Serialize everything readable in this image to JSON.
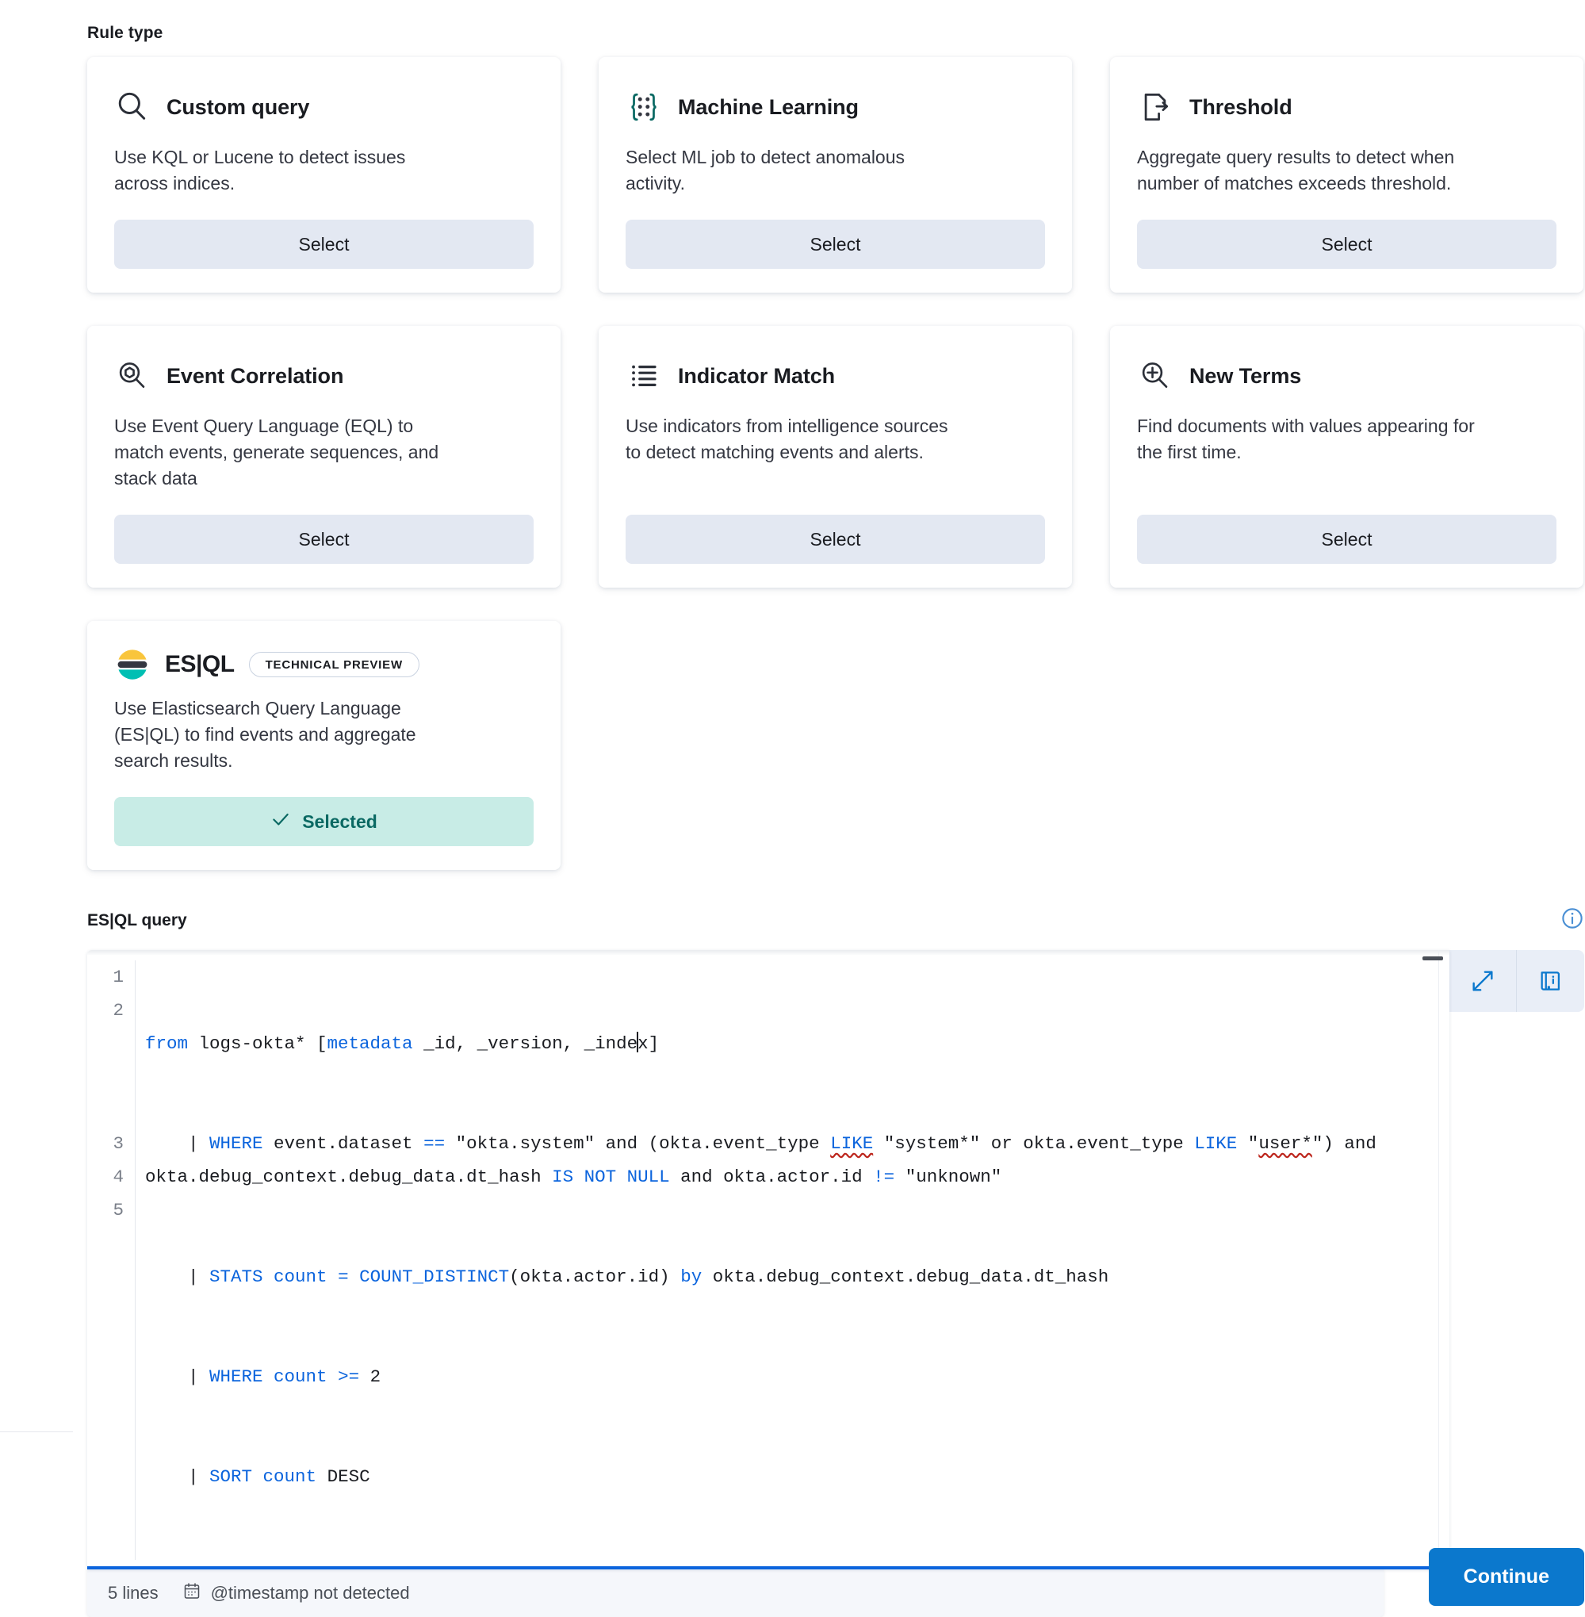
{
  "section": {
    "label": "Rule type"
  },
  "rule_types": [
    {
      "id": "custom-query",
      "icon": "search-icon",
      "title": "Custom query",
      "description": "Use KQL or Lucene to detect issues across indices.",
      "action_label": "Select",
      "selected": false
    },
    {
      "id": "machine-learning",
      "icon": "machine-learning-icon",
      "title": "Machine Learning",
      "description": "Select ML job to detect anomalous activity.",
      "action_label": "Select",
      "selected": false
    },
    {
      "id": "threshold",
      "icon": "threshold-icon",
      "title": "Threshold",
      "description": "Aggregate query results to detect when number of matches exceeds threshold.",
      "action_label": "Select",
      "selected": false
    },
    {
      "id": "event-correlation",
      "icon": "event-correlation-icon",
      "title": "Event Correlation",
      "description": "Use Event Query Language (EQL) to match events, generate sequences, and stack data",
      "action_label": "Select",
      "selected": false
    },
    {
      "id": "indicator-match",
      "icon": "indicator-match-icon",
      "title": "Indicator Match",
      "description": "Use indicators from intelligence sources to detect matching events and alerts.",
      "action_label": "Select",
      "selected": false
    },
    {
      "id": "new-terms",
      "icon": "new-terms-icon",
      "title": "New Terms",
      "description": "Find documents with values appearing for the first time.",
      "action_label": "Select",
      "selected": false
    }
  ],
  "esql_card": {
    "id": "esql",
    "icon": "elastic-logo-icon",
    "wordmark": "ES|QL",
    "badge": "TECHNICAL PREVIEW",
    "description": "Use Elasticsearch Query Language (ES|QL) to find events and aggregate search results.",
    "action_label": "Selected",
    "selected": true
  },
  "query_section": {
    "label": "ES|QL query",
    "info_icon": "info-circle-icon",
    "expand_icon": "expand-icon",
    "docs_icon": "documentation-book-icon",
    "line_numbers": [
      "1",
      "2",
      "3",
      "4",
      "5"
    ],
    "lines": [
      "from logs-okta* [metadata _id, _version, _index]",
      "    | WHERE event.dataset == \"okta.system\" and (okta.event_type LIKE \"system*\" or okta.event_type LIKE \"user*\") and okta.debug_context.debug_data.dt_hash IS NOT NULL and okta.actor.id != \"unknown\"",
      "    | STATS count = COUNT_DISTINCT(okta.actor.id) by okta.debug_context.debug_data.dt_hash",
      "    | WHERE count >= 2",
      "    | SORT count DESC"
    ],
    "footer": {
      "line_count": "5 lines",
      "timestamp_icon": "calendar-icon",
      "timestamp_status": "@timestamp not detected"
    }
  },
  "footer_actions": {
    "continue_label": "Continue"
  },
  "colors": {
    "accent_blue": "#0b78cd",
    "code_keyword": "#0b64dd",
    "selected_bg": "#c8ece6",
    "selected_text": "#0a6963",
    "select_bg": "#e3e8f2",
    "elastic_yellow": "#f9c53c",
    "elastic_teal": "#00bfb3",
    "elastic_dark": "#343741",
    "error_underline": "#bd271e"
  }
}
